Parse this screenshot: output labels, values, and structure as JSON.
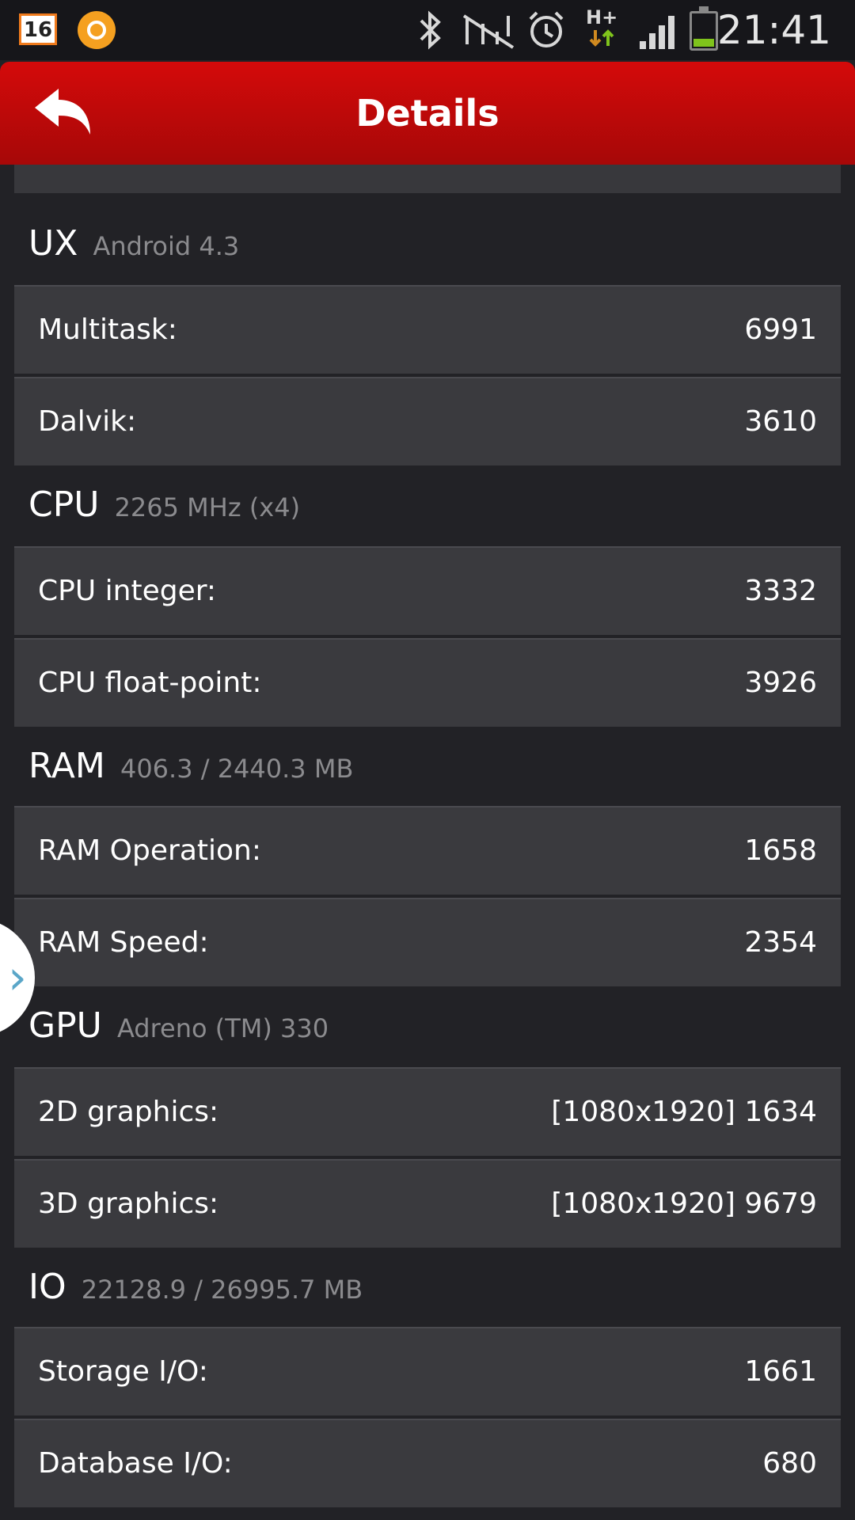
{
  "status_bar": {
    "calendar_day": "16",
    "icons": [
      "calendar-icon",
      "app-circle-icon",
      "bluetooth-icon",
      "nfc-icon",
      "alarm-icon",
      "hplus-data-icon",
      "signal-icon",
      "battery-icon"
    ],
    "network": "H+",
    "time": "21:41",
    "battery_color": "#7fc31c"
  },
  "header": {
    "title": "Details",
    "color": "#c40909"
  },
  "sections": [
    {
      "title": "UX",
      "subtitle": "Android 4.3",
      "rows": [
        {
          "label": "Multitask:",
          "value": "6991"
        },
        {
          "label": "Dalvik:",
          "value": "3610"
        }
      ]
    },
    {
      "title": "CPU",
      "subtitle": "2265 MHz (x4)",
      "rows": [
        {
          "label": "CPU integer:",
          "value": "3332"
        },
        {
          "label": "CPU float-point:",
          "value": "3926"
        }
      ]
    },
    {
      "title": "RAM",
      "subtitle": "406.3 / 2440.3 MB",
      "rows": [
        {
          "label": "RAM Operation:",
          "value": "1658"
        },
        {
          "label": "RAM Speed:",
          "value": "2354"
        }
      ]
    },
    {
      "title": "GPU",
      "subtitle": "Adreno (TM) 330",
      "rows": [
        {
          "label": "2D graphics:",
          "value": "[1080x1920] 1634"
        },
        {
          "label": "3D graphics:",
          "value": "[1080x1920] 9679"
        }
      ]
    },
    {
      "title": "IO",
      "subtitle": "22128.9 / 26995.7 MB",
      "rows": [
        {
          "label": "Storage I/O:",
          "value": "1661"
        },
        {
          "label": "Database I/O:",
          "value": "680"
        }
      ]
    }
  ],
  "side_tab": {
    "icon": "chevron-right-icon",
    "glyph": "›"
  }
}
